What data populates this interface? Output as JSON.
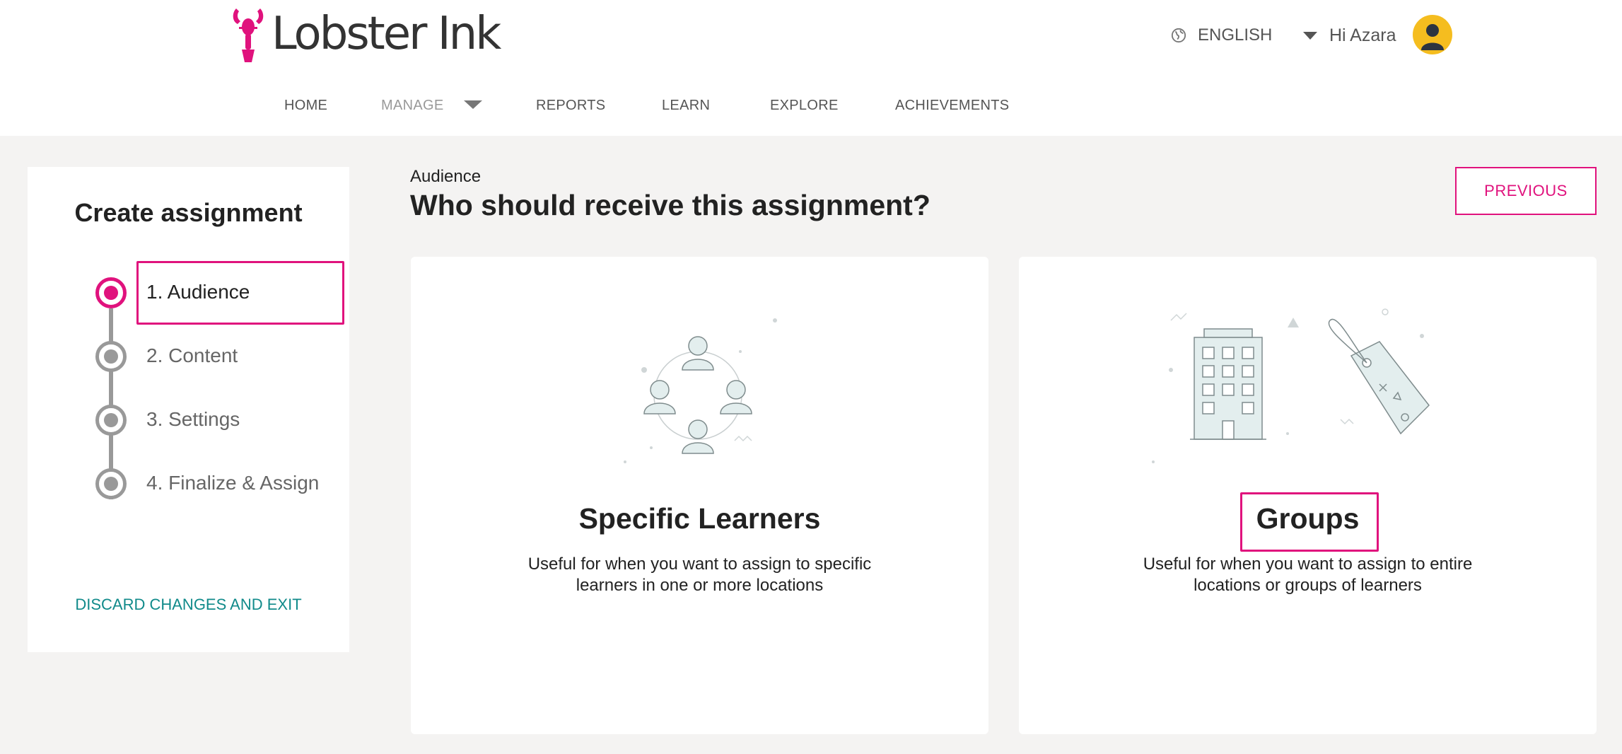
{
  "brand": {
    "name": "Lobster Ink",
    "accent": "#e0127d",
    "link_color": "#108a8a"
  },
  "header": {
    "language": "ENGLISH",
    "greeting": "Hi Azara",
    "icons": {
      "language": "globe-icon",
      "dropdown": "caret-down-icon",
      "avatar": "user-avatar-icon"
    }
  },
  "nav": {
    "items": [
      "HOME",
      "MANAGE",
      "REPORTS",
      "LEARN",
      "EXPLORE",
      "ACHIEVEMENTS"
    ],
    "active": "MANAGE"
  },
  "sidebar": {
    "title": "Create assignment",
    "steps": [
      "1. Audience",
      "2. Content",
      "3. Settings",
      "4. Finalize & Assign"
    ],
    "current_step": "1. Audience",
    "discard_label": "DISCARD CHANGES AND EXIT"
  },
  "main": {
    "eyebrow": "Audience",
    "title": "Who should receive this assignment?",
    "previous_label": "PREVIOUS",
    "cards": [
      {
        "title": "Specific Learners",
        "description": "Useful for when you want to assign to specific learners in one or more locations",
        "icon": "learners-group-illustration"
      },
      {
        "title": "Groups",
        "description": "Useful for when you want to assign to entire locations or groups of learners",
        "icon": "building-and-tag-illustration"
      }
    ]
  }
}
